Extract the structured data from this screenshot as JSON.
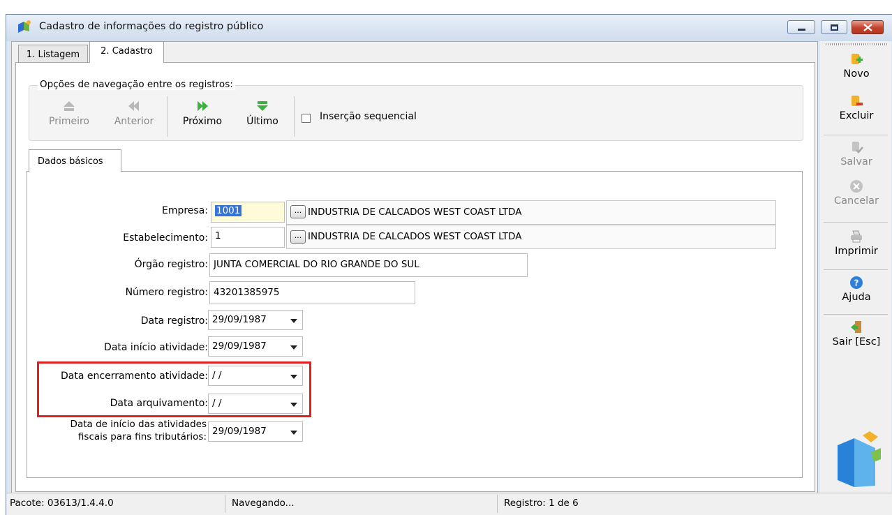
{
  "window": {
    "title": "Cadastro de informações do registro público",
    "colors": {
      "accent": "#2a6fd1",
      "highlight": "#e02020",
      "close": "#c4412a"
    }
  },
  "tabs": [
    {
      "label": "1. Listagem"
    },
    {
      "label": "2. Cadastro"
    }
  ],
  "navigation": {
    "legend": "Opções de navegação entre os registros:",
    "first": "Primeiro",
    "previous": "Anterior",
    "next": "Próximo",
    "last": "Último",
    "sequential_insert": "Inserção sequencial"
  },
  "subtab": {
    "label": "Dados básicos"
  },
  "form": {
    "empresa_label": "Empresa:",
    "empresa_code": "1001",
    "empresa_name": "INDUSTRIA DE CALCADOS WEST COAST LTDA",
    "estab_label": "Estabelecimento:",
    "estab_code": "1",
    "estab_name": "INDUSTRIA DE CALCADOS WEST COAST LTDA",
    "lookup_label": "...",
    "orgao_label": "Órgão registro:",
    "orgao_value": "JUNTA COMERCIAL DO RIO GRANDE DO SUL",
    "numero_label": "Número registro:",
    "numero_value": "43201385975",
    "data_registro_label": "Data registro:",
    "data_registro_value": "29/09/1987",
    "data_inicio_label": "Data início atividade:",
    "data_inicio_value": "29/09/1987",
    "data_encerramento_label": "Data encerramento atividade:",
    "data_encerramento_value": " / /",
    "data_arquivamento_label": "Data arquivamento:",
    "data_arquivamento_value": " / /",
    "data_fiscal_label_1": "Data de início das atividades",
    "data_fiscal_label_2": "fiscais para fins tributários:",
    "data_fiscal_value": "29/09/1987"
  },
  "toolbar": {
    "novo": "Novo",
    "excluir": "Excluir",
    "salvar": "Salvar",
    "cancelar": "Cancelar",
    "imprimir": "Imprimir",
    "ajuda": "Ajuda",
    "sair": "Sair [Esc]",
    "icons": [
      "add-icon",
      "delete-icon",
      "save-icon",
      "cancel-icon",
      "print-icon",
      "help-icon",
      "exit-icon"
    ]
  },
  "status": {
    "pacote": "Pacote: 03613/1.4.4.0",
    "estado": "Navegando...",
    "registro": "Registro: 1 de 6"
  }
}
